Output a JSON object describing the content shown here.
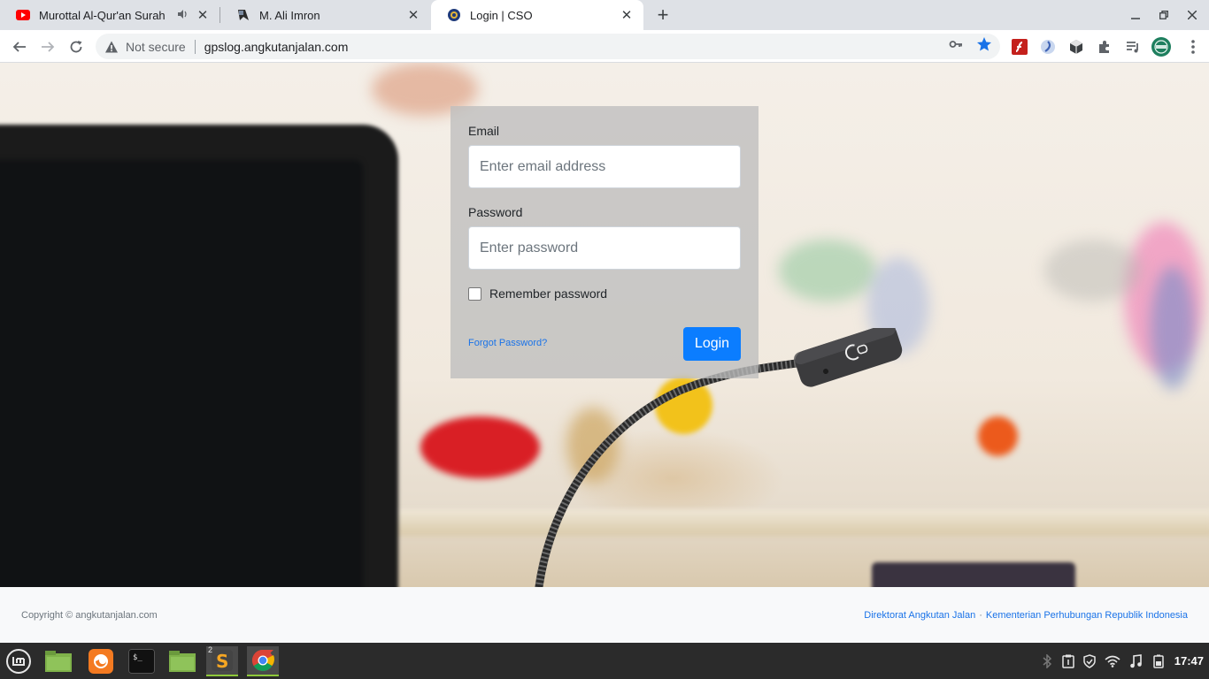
{
  "browser": {
    "tabs": [
      {
        "title": "Murottal Al-Qur'an Surah",
        "icon": "youtube-icon",
        "audio": true
      },
      {
        "title": "M. Ali Imron",
        "icon": "site-icon"
      },
      {
        "title": "Login | CSO",
        "icon": "logo-icon",
        "active": true
      }
    ],
    "security_label": "Not secure",
    "url": "gpslog.angkutanjalan.com"
  },
  "login": {
    "email_label": "Email",
    "email_placeholder": "Enter email address",
    "password_label": "Password",
    "password_placeholder": "Enter password",
    "remember_label": "Remember password",
    "forgot_label": "Forgot Password?",
    "submit_label": "Login"
  },
  "footer": {
    "copyright": "Copyright © angkutanjalan.com",
    "link_1": "Direktorat Angkutan Jalan",
    "separator": "·",
    "link_2": "Kementerian Perhubungan Republik Indonesia"
  },
  "taskbar": {
    "sublime_badge": "2",
    "clock": "17:47"
  },
  "colors": {
    "primary": "#0b7dff",
    "link": "#1a73e8",
    "accent_taskbar": "#8fc93a"
  }
}
